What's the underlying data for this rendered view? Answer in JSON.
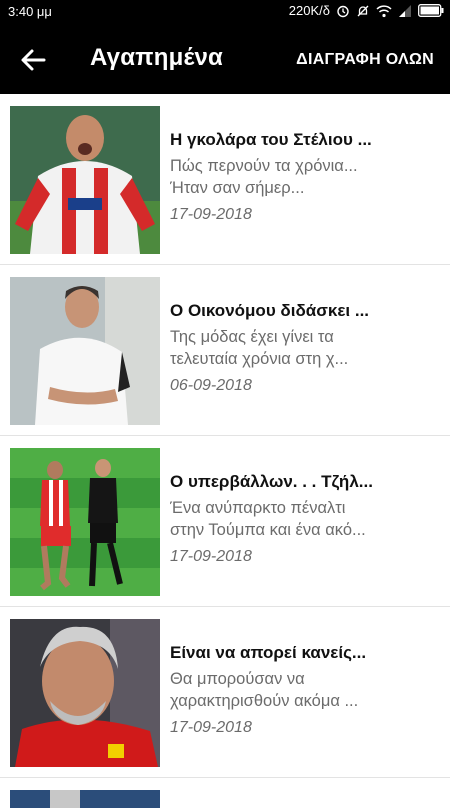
{
  "status_bar": {
    "time": "3:40 μμ",
    "network_speed": "220K/δ",
    "icons": [
      "alarm-icon",
      "notifications-off-icon",
      "wifi-icon",
      "signal-icon",
      "battery-icon"
    ]
  },
  "app_bar": {
    "back_icon": "arrow-left-icon",
    "title": "Αγαπημένα",
    "delete_all_label": "ΔΙΑΓΡΑΦΗ ΟΛΩΝ"
  },
  "articles": [
    {
      "title": "Η γκολάρα του Στέλιου ...",
      "summary": "Πώς περνούν τα χρόνια... Ήταν σαν σήμερ...",
      "date": "17-09-2018",
      "thumbnail": "player-celebrating-image"
    },
    {
      "title": "Ο Οικονόμου διδάσκει ...",
      "summary": "Της μόδας έχει γίνει τα τελευταία χρόνια στη χ...",
      "date": "06-09-2018",
      "thumbnail": "coach-portrait-image"
    },
    {
      "title": "Ο υπερβάλλων. . . Τζήλ...",
      "summary": "Ένα ανύπαρκτο πέναλτι στην Τούμπα και ένα ακό...",
      "date": "17-09-2018",
      "thumbnail": "referee-on-pitch-image"
    },
    {
      "title": "Είναι να απορεί κανείς...",
      "summary": "Θα μπορούσαν να χαρακτηρισθούν ακόμα ...",
      "date": "17-09-2018",
      "thumbnail": "team-principal-portrait-image"
    }
  ],
  "colors": {
    "app_bar_background": "#000000",
    "title_text": "#111111",
    "secondary_text": "#6b6b6b",
    "divider": "#e3e3e3"
  }
}
